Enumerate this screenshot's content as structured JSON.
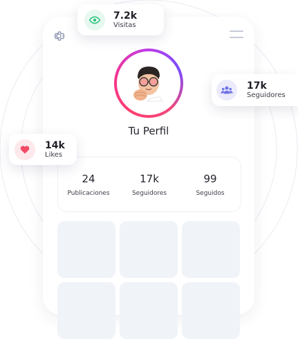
{
  "profile": {
    "name": "Tu Perfil"
  },
  "stats": [
    {
      "value": "24",
      "label": "Publicaciones"
    },
    {
      "value": "17k",
      "label": "Seguidores"
    },
    {
      "value": "99",
      "label": "Seguidos"
    }
  ],
  "badges": {
    "visits": {
      "value": "7.2k",
      "label": "Visitas",
      "icon": "eye-icon",
      "color": "#27c27a"
    },
    "followers": {
      "value": "17k",
      "label": "Seguidores",
      "icon": "users-icon",
      "color": "#6f72e8"
    },
    "likes": {
      "value": "14k",
      "label": "Likes",
      "icon": "heart-icon",
      "color": "#f24a66"
    }
  },
  "colors": {
    "ring_start": "#ff3d6f",
    "ring_end": "#7a4dff",
    "tile": "#f0f3f8"
  }
}
